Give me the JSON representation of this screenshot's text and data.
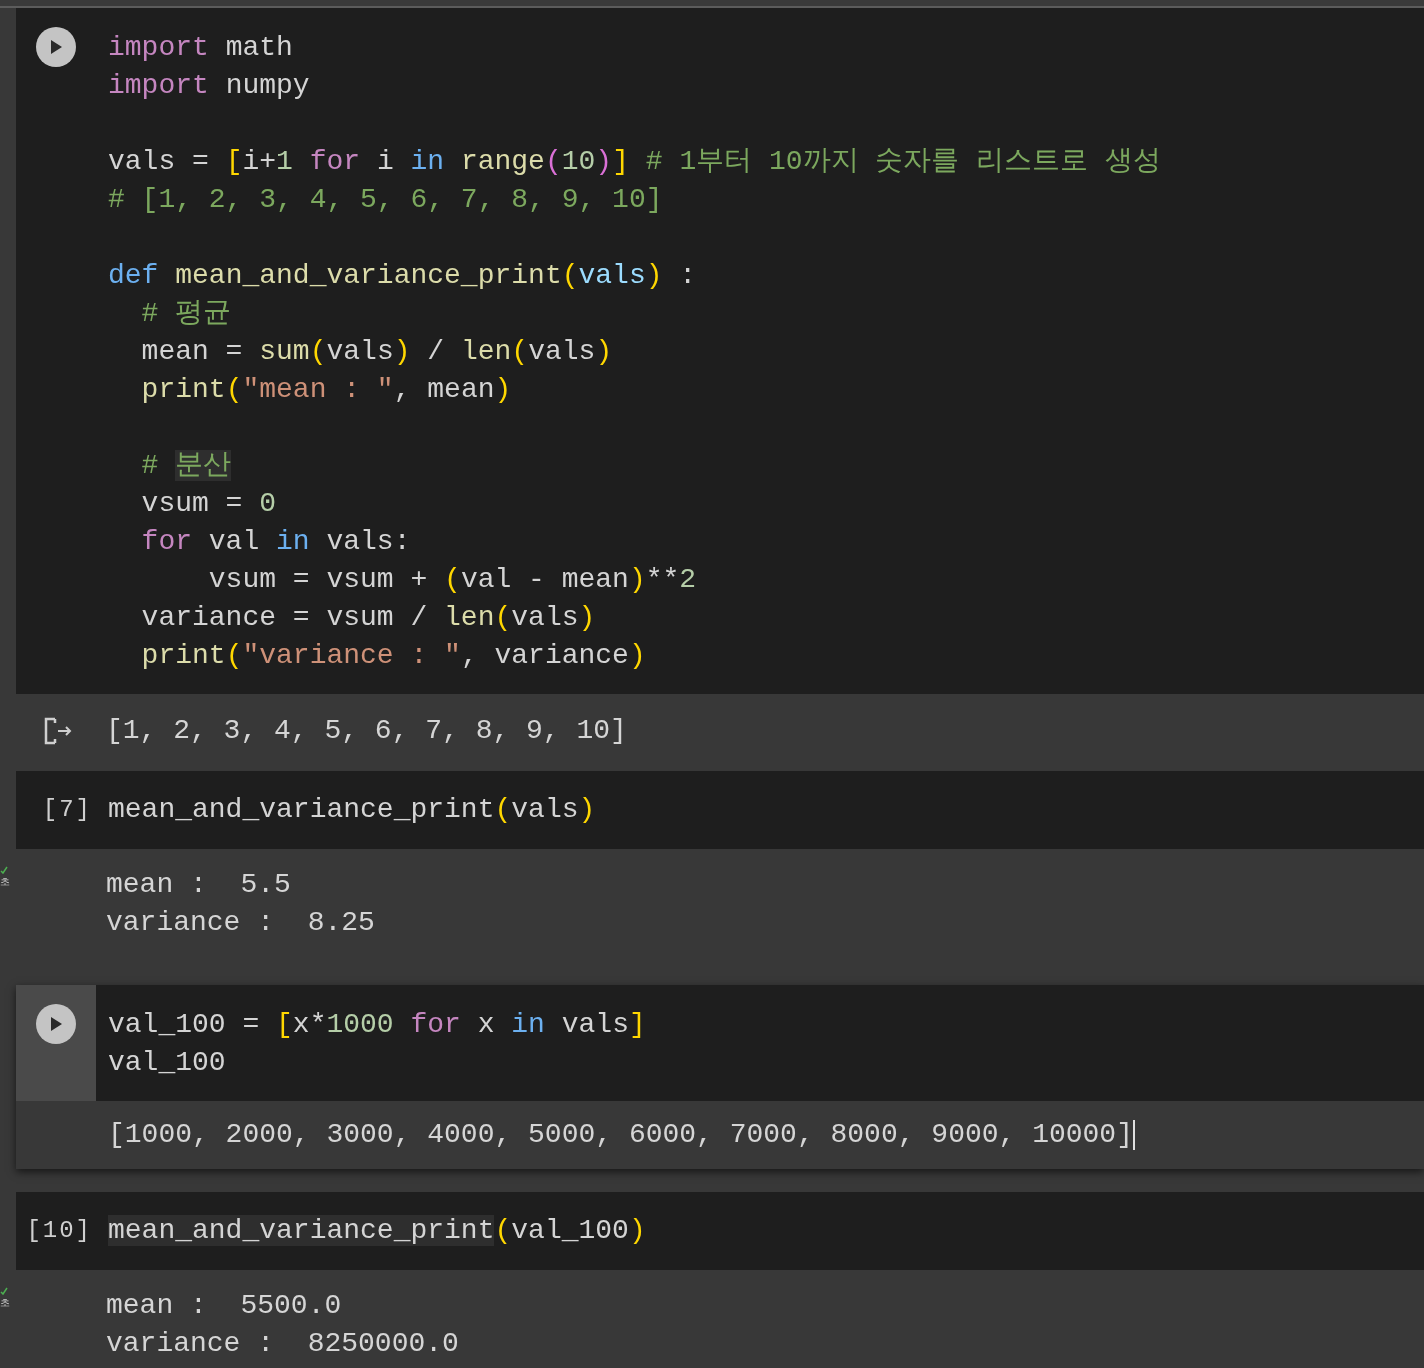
{
  "cells": [
    {
      "kind": "code",
      "focused": false,
      "run_button": true,
      "lines": [
        {
          "tokens": [
            {
              "kind": "kw",
              "text": "import"
            },
            {
              "kind": "p",
              "text": " math"
            }
          ]
        },
        {
          "tokens": [
            {
              "kind": "kw",
              "text": "import"
            },
            {
              "kind": "p",
              "text": " numpy"
            }
          ]
        },
        {
          "space_before": true,
          "tokens": [
            {
              "kind": "p",
              "text": "vals = "
            },
            {
              "kind": "br",
              "text": "["
            },
            {
              "kind": "p",
              "text": "i+"
            },
            {
              "kind": "num",
              "text": "1 "
            },
            {
              "kind": "kw",
              "text": "for"
            },
            {
              "kind": "p",
              "text": " i "
            },
            {
              "kind": "kw2",
              "text": "in"
            },
            {
              "kind": "fn",
              "text": " range"
            },
            {
              "kind": "br2",
              "text": "("
            },
            {
              "kind": "num",
              "text": "10"
            },
            {
              "kind": "br2",
              "text": ")"
            },
            {
              "kind": "br",
              "text": "]"
            },
            {
              "kind": "cm",
              "text": " # 1부터 10까지 숫자를 리스트로 생성"
            }
          ]
        },
        {
          "tokens": [
            {
              "kind": "cm",
              "text": "# [1, 2, 3, 4, 5, 6, 7, 8, 9, 10]"
            }
          ]
        },
        {
          "space_before": true,
          "tokens": [
            {
              "kind": "kw2",
              "text": "def"
            },
            {
              "kind": "fn",
              "text": " mean_and_variance_print"
            },
            {
              "kind": "br",
              "text": "("
            },
            {
              "kind": "var",
              "text": "vals"
            },
            {
              "kind": "br",
              "text": ")"
            },
            {
              "kind": "p",
              "text": " :"
            }
          ]
        },
        {
          "tokens": [
            {
              "kind": "cm",
              "text": "  # 평균"
            }
          ]
        },
        {
          "tokens": [
            {
              "kind": "p",
              "text": "  mean = "
            },
            {
              "kind": "fn",
              "text": "sum"
            },
            {
              "kind": "br",
              "text": "("
            },
            {
              "kind": "p",
              "text": "vals"
            },
            {
              "kind": "br",
              "text": ")"
            },
            {
              "kind": "p",
              "text": " / "
            },
            {
              "kind": "fn",
              "text": "len"
            },
            {
              "kind": "br",
              "text": "("
            },
            {
              "kind": "p",
              "text": "vals"
            },
            {
              "kind": "br",
              "text": ")"
            }
          ]
        },
        {
          "tokens": [
            {
              "kind": "fn",
              "text": "  print"
            },
            {
              "kind": "br",
              "text": "("
            },
            {
              "kind": "str",
              "text": "\"mean : \""
            },
            {
              "kind": "p",
              "text": ", mean"
            },
            {
              "kind": "br",
              "text": ")"
            }
          ]
        },
        {
          "space_before": true,
          "tokens": [
            {
              "kind": "cm",
              "text": "  # "
            },
            {
              "kind": "cm",
              "text": "분산",
              "highlighted": true
            }
          ]
        },
        {
          "tokens": [
            {
              "kind": "p",
              "text": "  vsum = "
            },
            {
              "kind": "num",
              "text": "0"
            }
          ]
        },
        {
          "tokens": [
            {
              "kind": "kw",
              "text": "  for"
            },
            {
              "kind": "p",
              "text": " val "
            },
            {
              "kind": "kw2",
              "text": "in"
            },
            {
              "kind": "p",
              "text": " vals:"
            }
          ]
        },
        {
          "tokens": [
            {
              "kind": "p",
              "text": "      vsum = vsum + "
            },
            {
              "kind": "br",
              "text": "("
            },
            {
              "kind": "p",
              "text": "val - mean"
            },
            {
              "kind": "br",
              "text": ")"
            },
            {
              "kind": "p",
              "text": "**"
            },
            {
              "kind": "num",
              "text": "2"
            }
          ]
        },
        {
          "tokens": [
            {
              "kind": "p",
              "text": "  variance = vsum / "
            },
            {
              "kind": "fn",
              "text": "len"
            },
            {
              "kind": "br",
              "text": "("
            },
            {
              "kind": "p",
              "text": "vals"
            },
            {
              "kind": "br",
              "text": ")"
            }
          ]
        },
        {
          "tokens": [
            {
              "kind": "fn",
              "text": "  print"
            },
            {
              "kind": "br",
              "text": "("
            },
            {
              "kind": "str",
              "text": "\"variance : \""
            },
            {
              "kind": "p",
              "text": ", variance"
            },
            {
              "kind": "br",
              "text": ")"
            }
          ]
        }
      ],
      "output": {
        "icon": true,
        "cursor": false,
        "lines": [
          "[1, 2, 3, 4, 5, 6, 7, 8, 9, 10]"
        ]
      }
    },
    {
      "kind": "code",
      "focused": false,
      "run_button": false,
      "count": "[7]",
      "succeeded": true,
      "duration": "초",
      "lines": [
        {
          "tokens": [
            {
              "kind": "p",
              "text": "mean_and_variance_print"
            },
            {
              "kind": "br",
              "text": "("
            },
            {
              "kind": "p",
              "text": "vals"
            },
            {
              "kind": "br",
              "text": ")"
            }
          ]
        }
      ],
      "output": {
        "icon": false,
        "cursor": false,
        "lines": [
          "mean :  5.5",
          "variance :  8.25"
        ]
      }
    },
    {
      "kind": "code",
      "focused": true,
      "run_button": true,
      "lines": [
        {
          "tokens": [
            {
              "kind": "p",
              "text": "val_100 = "
            },
            {
              "kind": "br",
              "text": "["
            },
            {
              "kind": "p",
              "text": "x*"
            },
            {
              "kind": "num",
              "text": "1000 "
            },
            {
              "kind": "kw",
              "text": "for"
            },
            {
              "kind": "p",
              "text": " x "
            },
            {
              "kind": "kw2",
              "text": "in"
            },
            {
              "kind": "p",
              "text": " vals"
            },
            {
              "kind": "br",
              "text": "]"
            }
          ]
        },
        {
          "tokens": [
            {
              "kind": "p",
              "text": "val_100"
            }
          ]
        }
      ],
      "output": {
        "icon": false,
        "cursor": true,
        "lines": [
          "[1000, 2000, 3000, 4000, 5000, 6000, 7000, 8000, 9000, 10000]"
        ]
      }
    },
    {
      "kind": "code",
      "focused": false,
      "run_button": false,
      "count": "[10]",
      "succeeded": true,
      "duration": "초",
      "lines": [
        {
          "tokens": [
            {
              "kind": "p",
              "text": "mean_and_variance_print",
              "highlighted": true
            },
            {
              "kind": "br",
              "text": "("
            },
            {
              "kind": "p",
              "text": "val_100"
            },
            {
              "kind": "br",
              "text": ")"
            }
          ]
        }
      ],
      "output": {
        "icon": false,
        "cursor": false,
        "lines": [
          "mean :  5500.0",
          "variance :  8250000.0"
        ]
      }
    }
  ]
}
